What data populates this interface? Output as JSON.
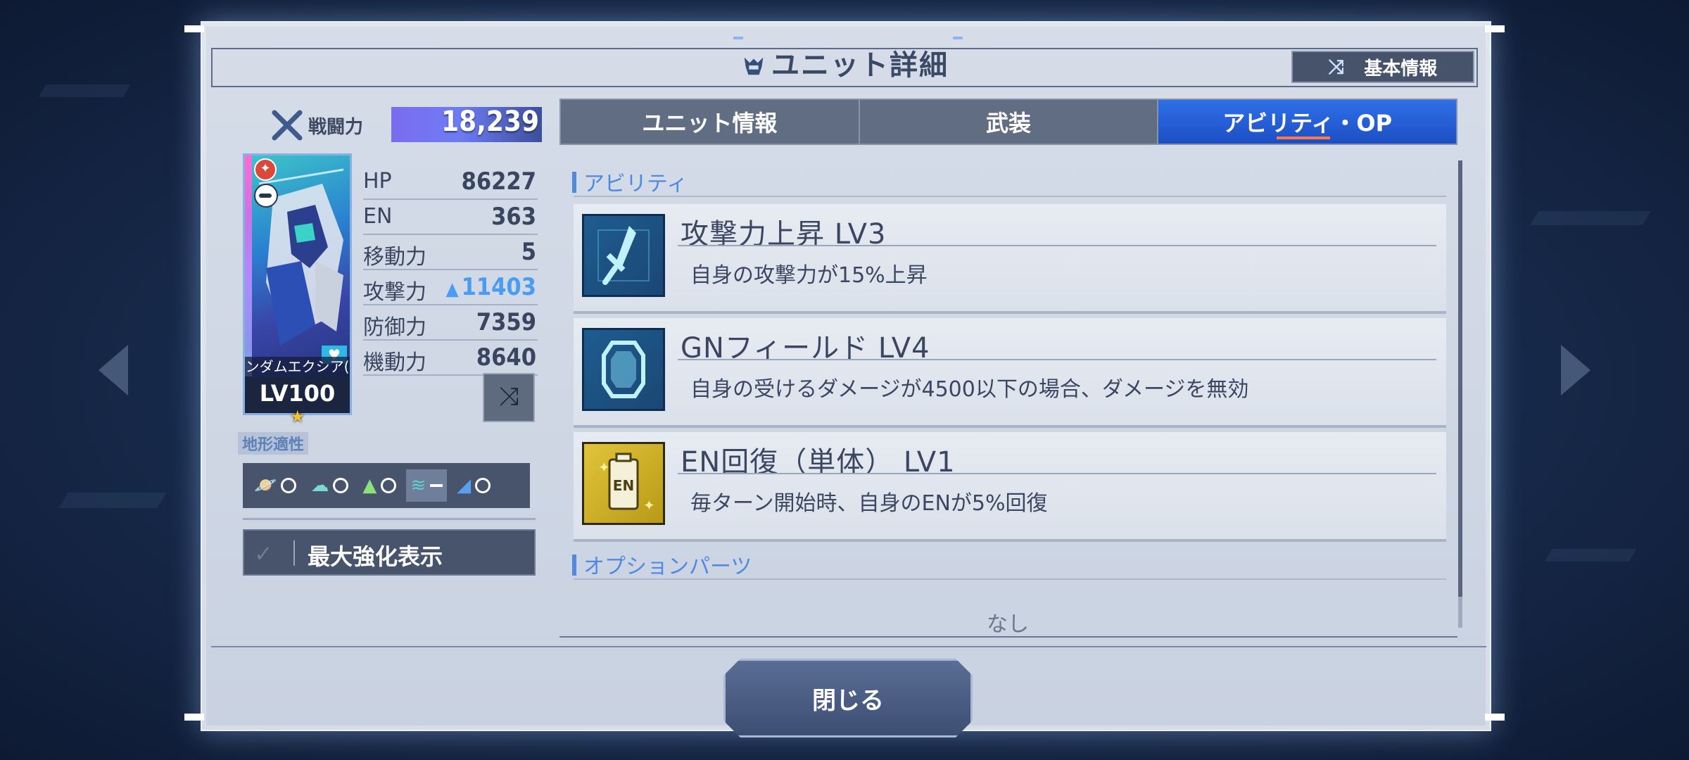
{
  "window": {
    "title": "ユニット詳細",
    "basic_info_button": "基本情報"
  },
  "power": {
    "label": "戦闘力",
    "value": "18,239"
  },
  "unit_card": {
    "name": "ンダムエクシア(",
    "level": "LV100",
    "star": "★"
  },
  "stats": [
    {
      "label": "HP",
      "value": "86227"
    },
    {
      "label": "EN",
      "value": "363"
    },
    {
      "label": "移動力",
      "value": "5"
    },
    {
      "label": "攻撃力",
      "value": "11403",
      "boosted": true
    },
    {
      "label": "防御力",
      "value": "7359"
    },
    {
      "label": "機動力",
      "value": "8640"
    }
  ],
  "terrain": {
    "label": "地形適性",
    "items": [
      {
        "icon": "space-icon",
        "grade": "○"
      },
      {
        "icon": "air-icon",
        "grade": "○"
      },
      {
        "icon": "land-icon",
        "grade": "○"
      },
      {
        "icon": "water-icon",
        "grade": "－"
      },
      {
        "icon": "underground-icon",
        "grade": "○"
      }
    ]
  },
  "max_enhance_button": "最大強化表示",
  "tabs": [
    {
      "label": "ユニット情報",
      "active": false
    },
    {
      "label": "武装",
      "active": false
    },
    {
      "label": "アビリティ・OP",
      "active": true
    }
  ],
  "ability_section": {
    "header": "アビリティ",
    "items": [
      {
        "name": "攻撃力上昇 LV3",
        "description": "自身の攻撃力が15%上昇",
        "icon": "sword-icon"
      },
      {
        "name": "GNフィールド LV4",
        "description": "自身の受けるダメージが4500以下の場合、ダメージを無効",
        "icon": "shield-icon"
      },
      {
        "name": "EN回復（単体） LV1",
        "description": "毎ターン開始時、自身のENが5%回復",
        "icon": "en-battery-icon",
        "icon_text": "EN"
      }
    ]
  },
  "option_section": {
    "header": "オプションパーツ",
    "empty_text": "なし"
  },
  "close_button": "閉じる",
  "colors": {
    "accent_blue": "#1d4fc4",
    "boost_blue": "#4a9cf2",
    "power_bar": "#7b6cf0",
    "panel": "#d6dde9"
  }
}
